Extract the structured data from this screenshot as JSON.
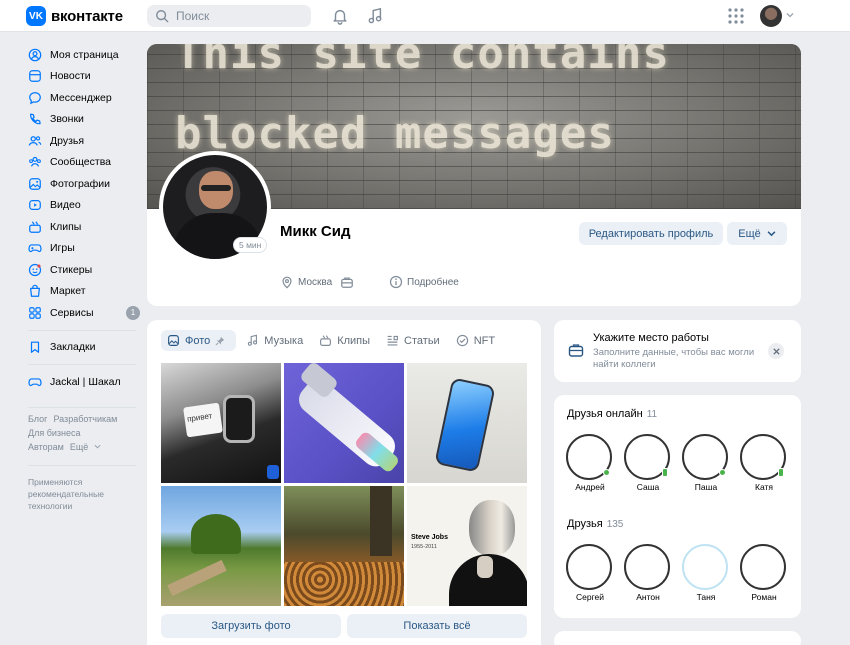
{
  "header": {
    "logo_text": "вконтакте",
    "logo_mark": "VK",
    "search_placeholder": "Поиск",
    "icons": [
      "bell-icon",
      "music-icon",
      "apps-grid-icon"
    ]
  },
  "nav": {
    "items": [
      {
        "label": "Моя страница",
        "icon": "user-circle-icon"
      },
      {
        "label": "Новости",
        "icon": "newspaper-icon"
      },
      {
        "label": "Мессенджер",
        "icon": "message-icon"
      },
      {
        "label": "Звонки",
        "icon": "phone-icon"
      },
      {
        "label": "Друзья",
        "icon": "users-icon"
      },
      {
        "label": "Сообщества",
        "icon": "communities-icon"
      },
      {
        "label": "Фотографии",
        "icon": "photo-icon"
      },
      {
        "label": "Видео",
        "icon": "video-icon"
      },
      {
        "label": "Клипы",
        "icon": "clips-icon"
      },
      {
        "label": "Игры",
        "icon": "gamepad-icon"
      },
      {
        "label": "Стикеры",
        "icon": "sticker-icon"
      },
      {
        "label": "Маркет",
        "icon": "market-icon"
      },
      {
        "label": "Сервисы",
        "icon": "services-icon",
        "badge": "1"
      }
    ],
    "bookmarks": "Закладки",
    "community": "Jackal | Шакал",
    "footer_links": [
      "Блог",
      "Разработчикам",
      "Для бизнеса",
      "Авторам",
      "Ещё"
    ],
    "recommendation_note": "Применяются рекомендательные технологии"
  },
  "profile": {
    "cover_line1": "This site contains",
    "cover_line2": "blocked messages",
    "name": "Микк Сид",
    "last_seen": "5 мин",
    "edit_button": "Редактировать профиль",
    "more_button": "Ещё",
    "city": "Москва",
    "details": "Подробнее"
  },
  "media": {
    "tabs": [
      {
        "label": "Фото",
        "active": true
      },
      {
        "label": "Музыка"
      },
      {
        "label": "Клипы"
      },
      {
        "label": "Статьи"
      },
      {
        "label": "NFT"
      }
    ],
    "photo_caption_watch": "привет",
    "photo_caption_jobs_title": "Steve Jobs",
    "photo_caption_jobs_years": "1955-2011",
    "upload_button": "Загрузить фото",
    "show_all_button": "Показать всё"
  },
  "work_card": {
    "title": "Укажите место работы",
    "subtitle": "Заполните данные, чтобы вас могли найти коллеги"
  },
  "friends_online": {
    "title": "Друзья онлайн",
    "count": "11",
    "people": [
      "Андрей",
      "Саша",
      "Паша",
      "Катя"
    ]
  },
  "friends": {
    "title": "Друзья",
    "count": "135",
    "people": [
      "Сергей",
      "Антон",
      "Таня",
      "Роман"
    ]
  },
  "colors": {
    "accent": "#0077ff",
    "link": "#2a5885",
    "background": "#ebedf0",
    "online": "#4bb34b"
  }
}
